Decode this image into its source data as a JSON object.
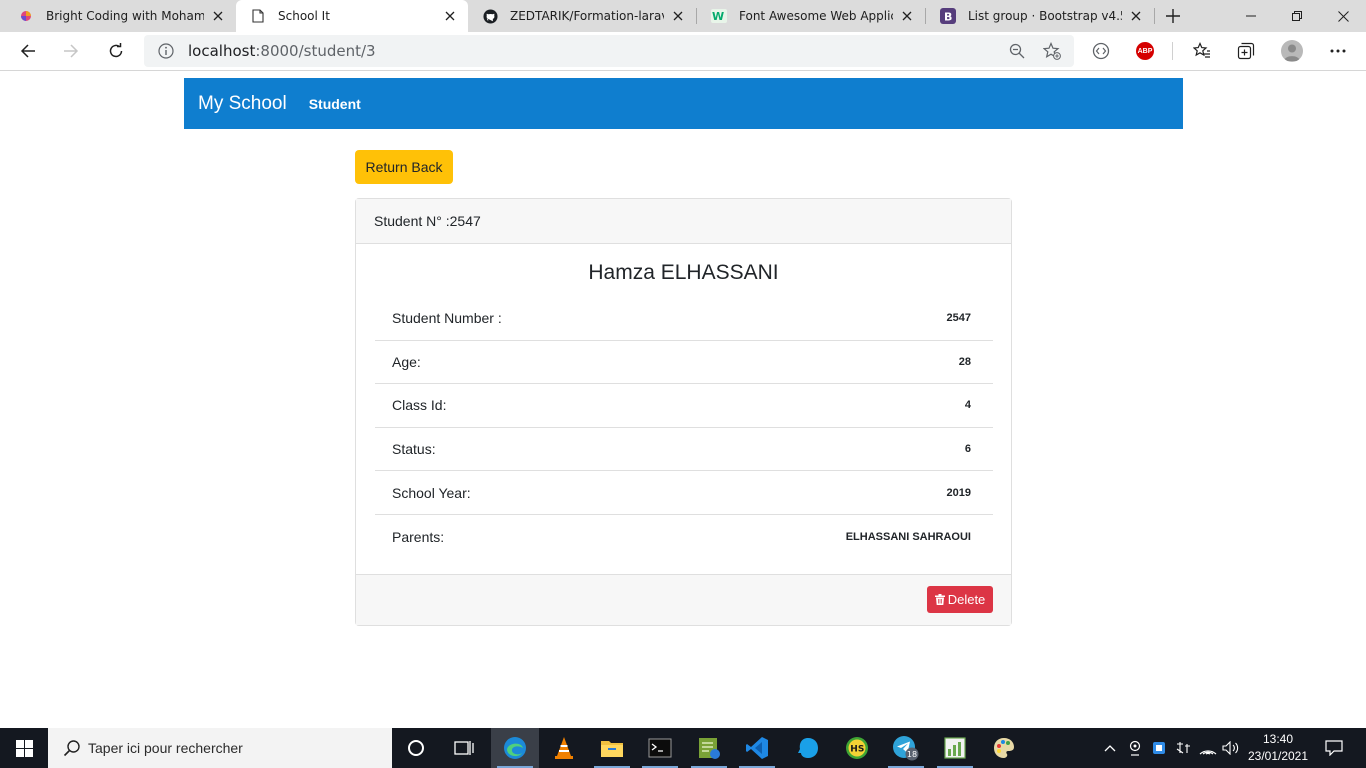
{
  "browser": {
    "tabs": [
      {
        "title": "Bright Coding with Mohamed E",
        "active": false
      },
      {
        "title": "School It",
        "active": true
      },
      {
        "title": "ZEDTARIK/Formation-laravel: F",
        "active": false
      },
      {
        "title": "Font Awesome Web Applicatio",
        "active": false
      },
      {
        "title": "List group · Bootstrap v4.5",
        "active": false
      }
    ],
    "url_host": "localhost",
    "url_path": ":8000/student/3"
  },
  "navbar": {
    "brand": "My School",
    "link": "Student"
  },
  "page": {
    "back_button": "Return Back",
    "card_header": "Student N° :2547",
    "student_name": "Hamza ELHASSANI",
    "details": [
      {
        "label": "Student Number :",
        "value": "2547"
      },
      {
        "label": "Age:",
        "value": "28"
      },
      {
        "label": "Class Id:",
        "value": "4"
      },
      {
        "label": "Status:",
        "value": "6"
      },
      {
        "label": "School Year:",
        "value": "2019"
      },
      {
        "label": "Parents:",
        "value": "ELHASSANI SAHRAOUI"
      }
    ],
    "delete_button": "Delete"
  },
  "taskbar": {
    "search_placeholder": "Taper ici pour rechercher",
    "telegram_badge": "18",
    "time": "13:40",
    "date": "23/01/2021"
  },
  "colors": {
    "navbar": "#0f7ecf",
    "back_button": "#ffc107",
    "delete_button": "#dc3545"
  }
}
